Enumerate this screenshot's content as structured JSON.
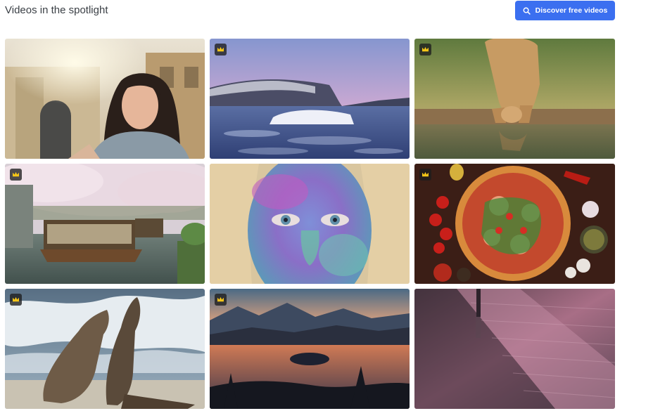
{
  "header": {
    "title": "Videos in the spotlight",
    "discover_label": "Discover free videos",
    "discover_icon": "search-icon",
    "accent": "#3b6ff0"
  },
  "videos": [
    {
      "subject": "woman-selfie-thumbnail",
      "premium": false
    },
    {
      "subject": "frozen-lake-thumbnail",
      "premium": true
    },
    {
      "subject": "lioness-drinking-thumbnail",
      "premium": true
    },
    {
      "subject": "cherry-blossom-boats-thumbnail",
      "premium": true
    },
    {
      "subject": "painted-face-thumbnail",
      "premium": false
    },
    {
      "subject": "pizza-thumbnail",
      "premium": true
    },
    {
      "subject": "sea-lions-thumbnail",
      "premium": true
    },
    {
      "subject": "lake-sunset-thumbnail",
      "premium": true
    },
    {
      "subject": "rainy-street-thumbnail",
      "premium": false
    }
  ],
  "premium_badge_icon": "crown-icon"
}
